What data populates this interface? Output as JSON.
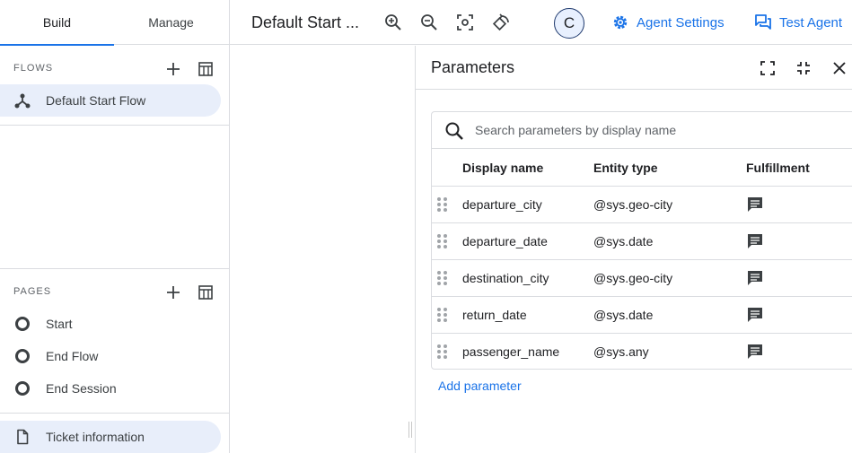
{
  "tabs": {
    "build": "Build",
    "manage": "Manage"
  },
  "flows": {
    "header": "FLOWS",
    "items": [
      {
        "label": "Default Start Flow",
        "icon": "flow-icon",
        "selected": true
      }
    ]
  },
  "pages": {
    "header": "PAGES",
    "items": [
      {
        "label": "Start",
        "icon": "circle-icon"
      },
      {
        "label": "End Flow",
        "icon": "circle-icon"
      },
      {
        "label": "End Session",
        "icon": "circle-icon"
      }
    ],
    "selected_item": {
      "label": "Ticket information",
      "icon": "document-icon"
    }
  },
  "toolbar": {
    "flow_title": "Default Start ...",
    "avatar_letter": "C",
    "agent_settings": "Agent Settings",
    "test_agent": "Test Agent",
    "accent_color": "#1a73e8"
  },
  "parameters": {
    "title": "Parameters",
    "search_placeholder": "Search parameters by display name",
    "columns": {
      "display_name": "Display name",
      "entity_type": "Entity type",
      "fulfillment": "Fulfillment"
    },
    "rows": [
      {
        "name": "departure_city",
        "entity": "@sys.geo-city"
      },
      {
        "name": "departure_date",
        "entity": "@sys.date"
      },
      {
        "name": "destination_city",
        "entity": "@sys.geo-city"
      },
      {
        "name": "return_date",
        "entity": "@sys.date"
      },
      {
        "name": "passenger_name",
        "entity": "@sys.any"
      }
    ],
    "add_label": "Add parameter"
  }
}
